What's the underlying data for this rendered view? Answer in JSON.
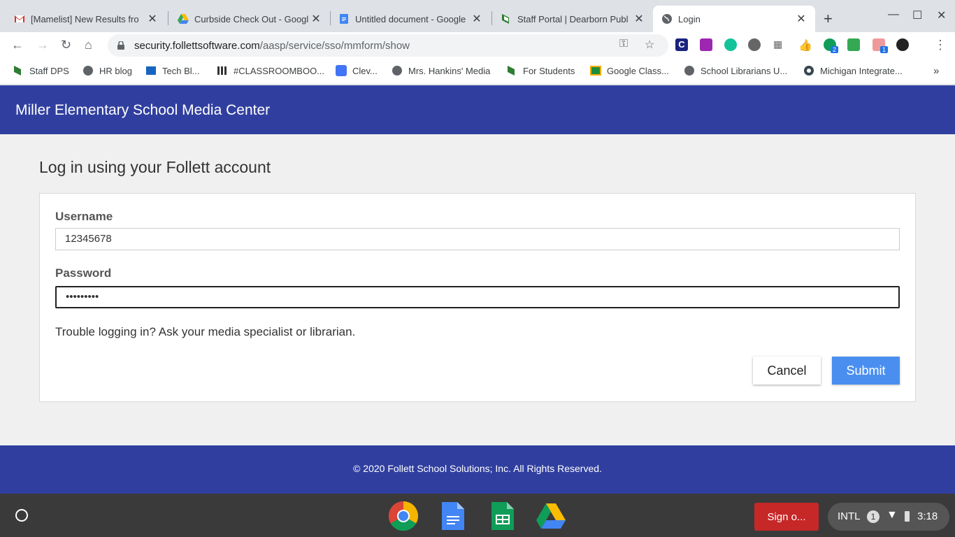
{
  "browser": {
    "tabs": [
      {
        "title": "[Mamelist] New Results fro",
        "favicon_text": "2"
      },
      {
        "title": "Curbside Check Out - Googl"
      },
      {
        "title": "Untitled document - Google"
      },
      {
        "title": "Staff Portal | Dearborn Publ"
      },
      {
        "title": "Login"
      }
    ],
    "new_tab": "+",
    "url_host": "security.follettsoftware.com",
    "url_path": "/aasp/service/sso/mmform/show",
    "extensions": {
      "badge_chat": "2",
      "badge_ext": "1"
    },
    "bookmarks": [
      "Staff DPS",
      "HR blog",
      "Tech Bl...",
      "#CLASSROOMBOO...",
      "Clev...",
      "Mrs. Hankins' Media",
      "For Students",
      "Google Class...",
      "School Librarians U...",
      "Michigan Integrate..."
    ],
    "bookmarks_overflow": "»"
  },
  "page": {
    "site_title": "Miller Elementary School Media Center",
    "heading": "Log in using your Follett account",
    "username_label": "Username",
    "username_value": "12345678",
    "password_label": "Password",
    "password_value": "•••••••••",
    "help_text": "Trouble logging in? Ask your media specialist or librarian.",
    "cancel_label": "Cancel",
    "submit_label": "Submit",
    "footer": "© 2020 Follett School Solutions; Inc. All Rights Reserved."
  },
  "shelf": {
    "signout_label": "Sign o...",
    "ime": "INTL",
    "notification_count": "1",
    "time": "3:18"
  },
  "colors": {
    "header_blue": "#303f9f",
    "submit_blue": "#4a8ff0",
    "signout_red": "#c62828"
  }
}
